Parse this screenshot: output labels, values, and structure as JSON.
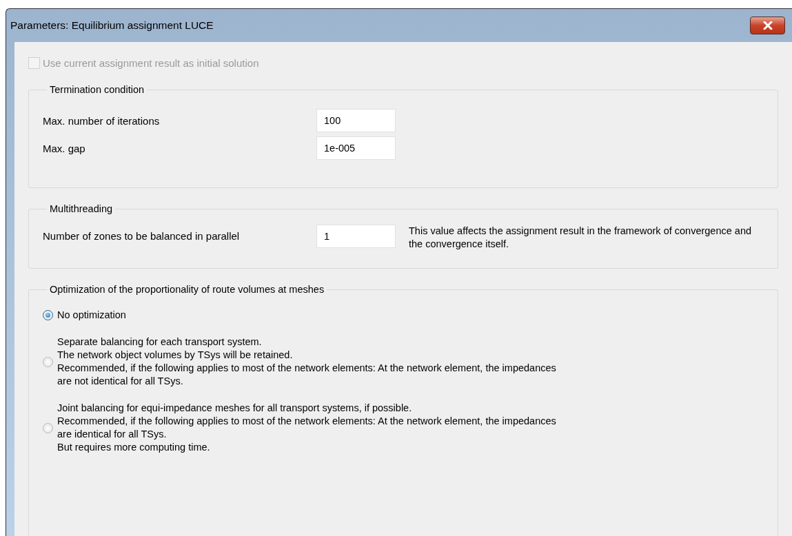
{
  "window": {
    "title": "Parameters: Equilibrium assignment LUCE"
  },
  "initial_solution": {
    "label": "Use current assignment result as initial solution",
    "checked": false,
    "disabled": true
  },
  "termination": {
    "title": "Termination condition",
    "fields": [
      {
        "label": "Max. number of iterations",
        "value": "100"
      },
      {
        "label": "Max. gap",
        "value": "1e-005"
      }
    ]
  },
  "multithreading": {
    "title": "Multithreading",
    "label": "Number of zones to be balanced in parallel",
    "value": "1",
    "note": "This value affects the assignment result in the framework of convergence and the convergence itself."
  },
  "optimization": {
    "title": "Optimization of the proportionality of route volumes at meshes",
    "options": [
      {
        "lines": [
          "No optimization"
        ],
        "selected": true
      },
      {
        "lines": [
          "Separate balancing for each transport system.",
          "The network object volumes by TSys will be retained.",
          "Recommended, if the following applies to most of the network elements: At the network element, the impedances",
          "are not identical for all TSys."
        ],
        "selected": false
      },
      {
        "lines": [
          "Joint balancing for equi-impedance meshes for all transport systems, if possible.",
          "Recommended, if the following applies to most of the network elements: At the network element, the impedances",
          "are identical for all TSys.",
          "But requires more computing time."
        ],
        "selected": false
      }
    ]
  }
}
